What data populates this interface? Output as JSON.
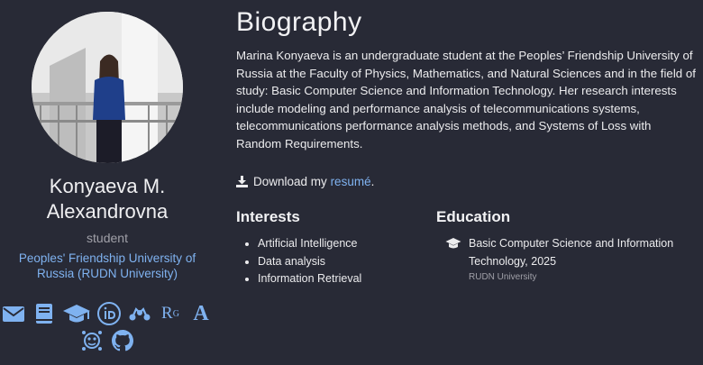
{
  "profile": {
    "name": "Konyaeva M. Alexandrovna",
    "role": "student",
    "organization": "Peoples' Friendship University of Russia (RUDN University)",
    "socials": [
      {
        "name": "email-icon"
      },
      {
        "name": "book-icon"
      },
      {
        "name": "graduation-cap-icon"
      },
      {
        "name": "orcid-icon"
      },
      {
        "name": "mendeley-icon"
      },
      {
        "name": "researchgate-icon",
        "text": "R",
        "sup": "G"
      },
      {
        "name": "academia-icon",
        "text": "A"
      },
      {
        "name": "robot-face-icon"
      },
      {
        "name": "github-icon"
      }
    ],
    "accent_color": "#7fb2f0"
  },
  "biography": {
    "heading": "Biography",
    "text": "Marina Konyaeva is an undergraduate student at the Peoples’ Friendship University of Russia at the Faculty of Physics, Mathematics, and Natural Sciences and in the field of study: Basic Computer Science and Information Technology. Her research interests include modeling and performance analysis of telecommunications systems, telecommunications performance analysis methods, and Systems of Loss with Random Requirements.",
    "download_prefix": "Download my",
    "download_link": "resumé",
    "download_suffix": "."
  },
  "interests": {
    "heading": "Interests",
    "items": [
      "Artificial Intelligence",
      "Data analysis",
      "Information Retrieval"
    ]
  },
  "education": {
    "heading": "Education",
    "items": [
      {
        "course": "Basic Computer Science and Information Technology, 2025",
        "institution": "RUDN University"
      }
    ]
  },
  "colors": {
    "background": "#282a36",
    "text": "#ececee",
    "muted": "#a0a0a8"
  }
}
